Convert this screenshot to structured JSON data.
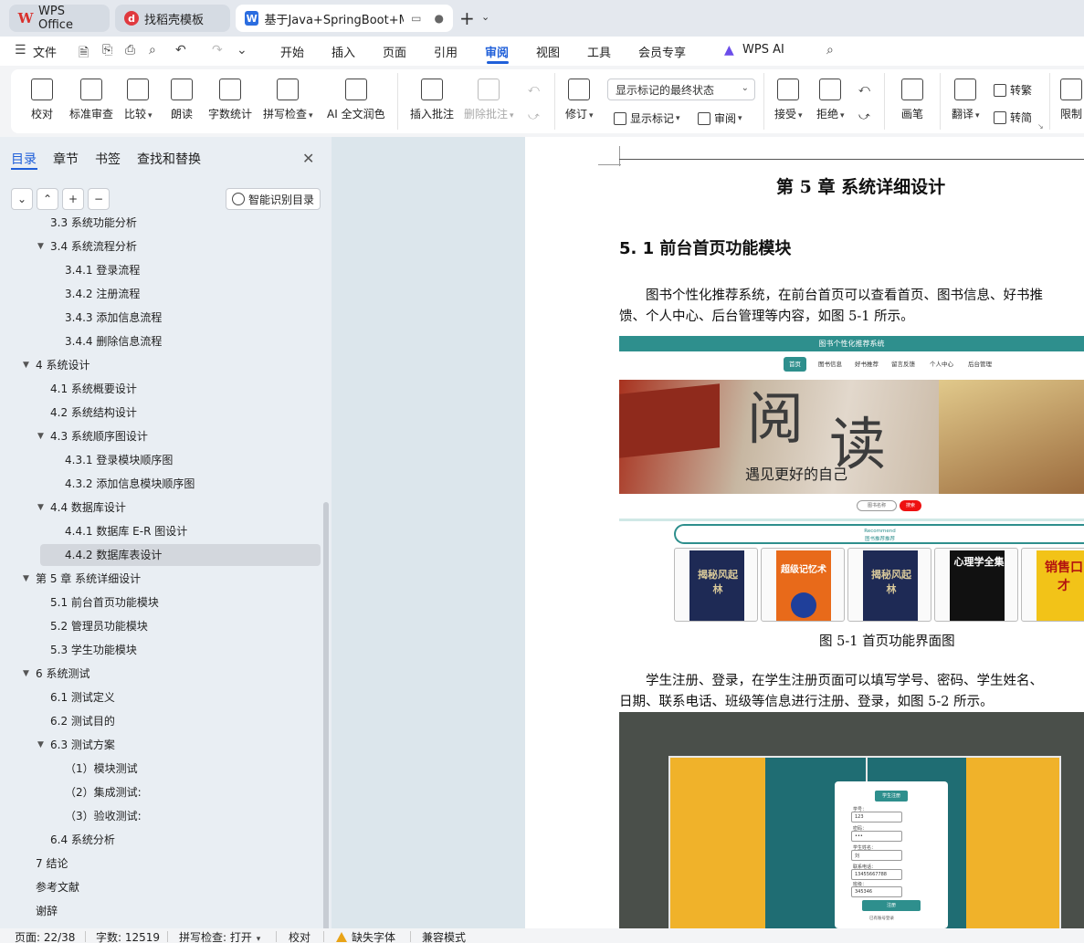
{
  "tabs": [
    {
      "label": "WPS Office",
      "icon": "wps-logo-icon"
    },
    {
      "label": "找稻壳模板",
      "icon": "docer-icon"
    },
    {
      "label": "基于Java+SpringBoot+MyS",
      "icon": "word-doc-icon"
    }
  ],
  "menu": {
    "file": "文件",
    "items": [
      "开始",
      "插入",
      "页面",
      "引用",
      "审阅",
      "视图",
      "工具",
      "会员专享",
      "WPS AI"
    ],
    "active": "审阅"
  },
  "ribbon": {
    "proofread": "校对",
    "standard_review": "标准审查",
    "compare": "比较",
    "read_aloud": "朗读",
    "word_count": "字数统计",
    "spell_check": "拼写检查",
    "ai_polish": "AI 全文润色",
    "insert_comment": "插入批注",
    "delete_comment": "删除批注",
    "track_changes": "修订",
    "display_markup": "显示标记",
    "review": "审阅",
    "markup_mode": "显示标记的最终状态",
    "accept": "接受",
    "reject": "拒绝",
    "ink": "画笔",
    "translate": "翻译",
    "to_traditional": "转繁",
    "to_simplified": "转简",
    "restrict": "限制"
  },
  "nav": {
    "tabs": [
      "目录",
      "章节",
      "书签",
      "查找和替换"
    ],
    "active_tab": "目录",
    "smart_button": "智能识别目录",
    "toc": [
      {
        "text": "3.3  系统功能分析",
        "level": 2,
        "expand": false
      },
      {
        "text": "3.4 系统流程分析",
        "level": 2,
        "expand": true
      },
      {
        "text": "3.4.1 登录流程",
        "level": 3
      },
      {
        "text": "3.4.2 注册流程",
        "level": 3
      },
      {
        "text": "3.4.3 添加信息流程",
        "level": 3
      },
      {
        "text": "3.4.4 删除信息流程",
        "level": 3
      },
      {
        "text": "4   系统设计",
        "level": 1,
        "expand": true
      },
      {
        "text": "4.1 系统概要设计",
        "level": 2
      },
      {
        "text": "4.2 系统结构设计",
        "level": 2
      },
      {
        "text": "4.3 系统顺序图设计",
        "level": 2,
        "expand": true
      },
      {
        "text": "4.3.1 登录模块顺序图",
        "level": 3
      },
      {
        "text": "4.3.2 添加信息模块顺序图",
        "level": 3
      },
      {
        "text": "4.4 数据库设计",
        "level": 2,
        "expand": true
      },
      {
        "text": "4.4.1 数据库 E-R 图设计",
        "level": 3
      },
      {
        "text": "4.4.2 数据库表设计",
        "level": 3,
        "selected": true
      },
      {
        "text": "第 5 章  系统详细设计",
        "level": 1,
        "expand": true
      },
      {
        "text": "5.1 前台首页功能模块",
        "level": 2
      },
      {
        "text": "5.2 管理员功能模块",
        "level": 2
      },
      {
        "text": "5.3 学生功能模块",
        "level": 2
      },
      {
        "text": "6  系统测试",
        "level": 1,
        "expand": true
      },
      {
        "text": "6.1  测试定义",
        "level": 2
      },
      {
        "text": "6.2  测试目的",
        "level": 2
      },
      {
        "text": "6.3 测试方案",
        "level": 2,
        "expand": true
      },
      {
        "text": "（1）模块测试",
        "level": 3
      },
      {
        "text": "（2）集成测试:",
        "level": 3
      },
      {
        "text": "（3）验收测试:",
        "level": 3
      },
      {
        "text": "6.4 系统分析",
        "level": 2
      },
      {
        "text": "7  结论",
        "level": 1
      },
      {
        "text": "参考文献",
        "level": 1
      },
      {
        "text": "谢辞",
        "level": 1
      }
    ]
  },
  "document": {
    "chapter_title": "第 5 章  系统详细设计",
    "section_title": "5. 1 前台首页功能模块",
    "para1_line1": "图书个性化推荐系统，在前台首页可以查看首页、图书信息、好书推",
    "para1_line2": "馈、个人中心、后台管理等内容，如图 5-1 所示。",
    "fig1_caption": "图 5-1 首页功能界面图",
    "para2_line1": "学生注册、登录，在学生注册页面可以填写学号、密码、学生姓名、",
    "para2_line2": "日期、联系电话、班级等信息进行注册、登录，如图 5-2 所示。",
    "fig1": {
      "site_title": "图书个性化推荐系统",
      "nav": [
        "首页",
        "图书信息",
        "好书推荐",
        "留言反馈",
        "个人中心",
        "后台管理"
      ],
      "banner_char1": "阅",
      "banner_char2": "读",
      "slogan": "遇见更好的自己",
      "search_placeholder": "图书名称",
      "search_button": "搜索",
      "reco_en": "Recommend",
      "reco_cn": "图书推荐推荐",
      "books": [
        "揭秘风起林",
        "超级记忆术",
        "揭秘风起林",
        "心理学全集",
        "销售口才"
      ]
    },
    "fig2": {
      "form_title": "学生注册",
      "fields": [
        {
          "label": "学号：",
          "value": "123"
        },
        {
          "label": "密码：",
          "value": "•••"
        },
        {
          "label": "学生姓名：",
          "value": "刘"
        },
        {
          "label": "联系电话：",
          "value": "13455667788"
        },
        {
          "label": "班级：",
          "value": "345346"
        }
      ],
      "register_button": "注册",
      "login_link": "已有账号登录"
    }
  },
  "status": {
    "page": "页面: 22/38",
    "words": "字数: 12519",
    "spell": "拼写检查: 打开",
    "proof": "校对",
    "missing_font": "缺失字体",
    "compat": "兼容模式"
  },
  "colors": {
    "accent": "#1f5fd9",
    "site_teal": "#2e8f8d",
    "nav_bg": "#e9eef3",
    "doc_bg": "#dce6ec"
  }
}
